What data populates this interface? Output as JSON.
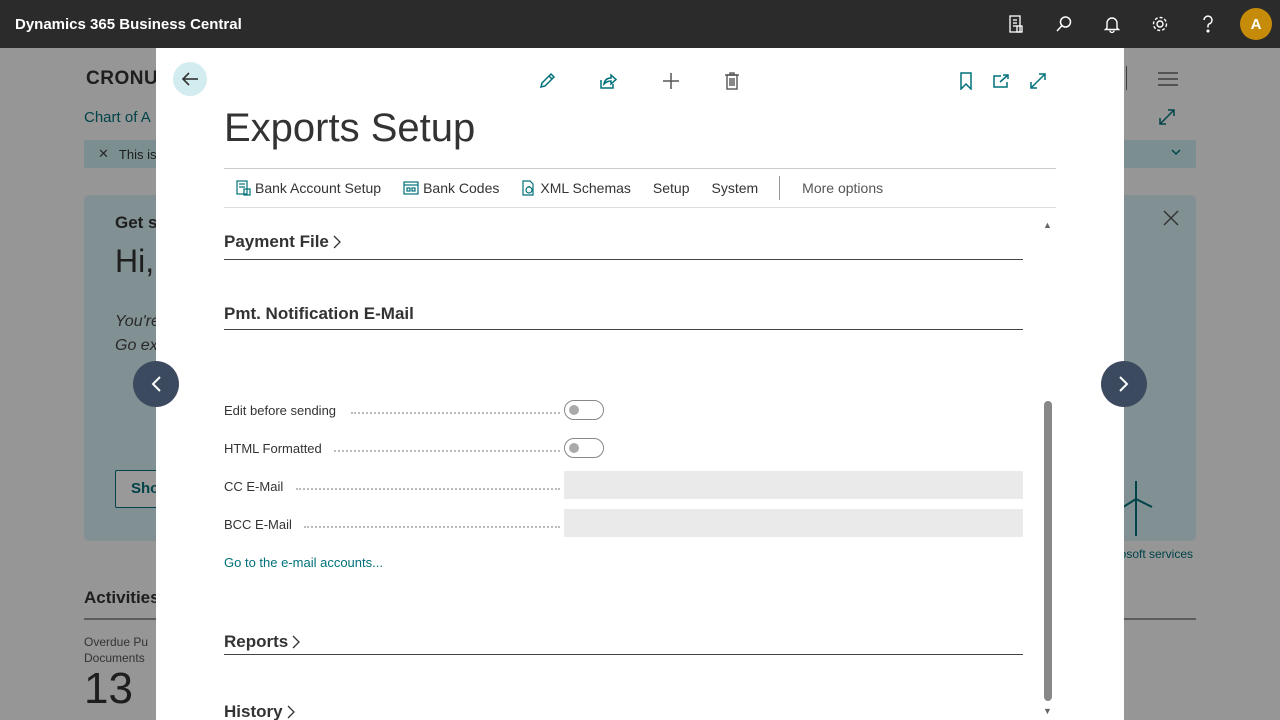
{
  "app": {
    "title": "Dynamics 365 Business Central",
    "avatar_initial": "A",
    "icons": [
      "document-icon",
      "search-icon",
      "bell-icon",
      "gear-icon",
      "help-icon"
    ]
  },
  "background": {
    "company_title": "CRONU",
    "breadcrumb_link": "Chart of A",
    "banner_text": "This is",
    "card_heading": "Get s",
    "card_greeting": "Hi,",
    "card_line1": "You're",
    "card_line2": "Go ex",
    "card_button": "Sho",
    "ms_services": "osoft services",
    "activities_heading": "Activities",
    "cue_label_1": "Overdue Pu",
    "cue_label_2": "Documents",
    "cue_value": "13"
  },
  "modal": {
    "title": "Exports Setup",
    "toolbar": {
      "edit": "edit-icon",
      "share": "share-icon",
      "new": "plus-icon",
      "delete": "delete-icon",
      "bookmark": "bookmark-icon",
      "open_new": "open-in-new-window-icon",
      "expand": "expand-icon"
    },
    "actions": [
      {
        "label": "Bank Account Setup"
      },
      {
        "label": "Bank Codes"
      },
      {
        "label": "XML Schemas"
      },
      {
        "label": "Setup"
      },
      {
        "label": "System"
      }
    ],
    "more_options": "More options",
    "sections": {
      "payment_file": "Payment File",
      "pmt_notification": "Pmt. Notification E-Mail",
      "reports": "Reports",
      "history": "History"
    },
    "fields": {
      "edit_before_sending": {
        "label": "Edit before sending",
        "value": false
      },
      "html_formatted": {
        "label": "HTML Formatted",
        "value": false
      },
      "cc_email": {
        "label": "CC E-Mail",
        "value": ""
      },
      "bcc_email": {
        "label": "BCC E-Mail",
        "value": ""
      }
    },
    "email_accounts_link": "Go to the e-mail accounts..."
  }
}
